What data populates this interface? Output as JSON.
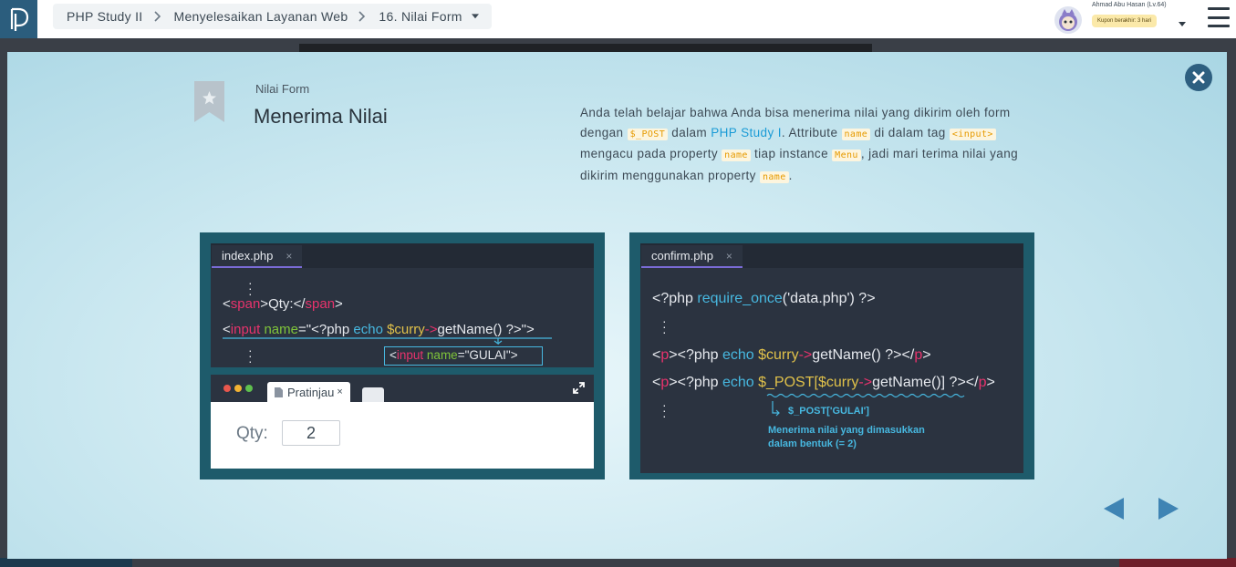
{
  "breadcrumb": {
    "course": "PHP Study II",
    "chapter": "Menyelesaikan Layanan Web",
    "lesson": "16. Nilai Form"
  },
  "user": {
    "name": "Ahmad Abu Hasan (Lv.64)",
    "coupon": "Kupon berakhir: 3 hari"
  },
  "slide": {
    "section": "Nilai Form",
    "title": "Menerima Nilai",
    "desc": {
      "t1": "Anda telah belajar bahwa Anda bisa menerima nilai yang dikirim oleh form dengan ",
      "c1": "$_POST",
      "t2": " dalam ",
      "link": "PHP Study I",
      "t3": ". Attribute ",
      "c2": "name",
      "t4": " di dalam tag ",
      "c3": "<input>",
      "t5": " mengacu pada property ",
      "c4": "name",
      "t6": " tiap instance ",
      "c5": "Menu",
      "t7": ", jadi mari terima nilai yang dikirim menggunakan property ",
      "c6": "name",
      "t8": "."
    }
  },
  "left_figure": {
    "tab": "index.php",
    "tab_close": "×",
    "line1": {
      "lt": "<",
      "tag": "span",
      "gt": ">",
      "text": "Qty:",
      "lt2": "</",
      "tag2": "span",
      "gt2": ">"
    },
    "line2": {
      "lt": "<",
      "tag": "input",
      "attr": " name",
      "eq": "=\"",
      "php": "<?php ",
      "echo": "echo ",
      "var": "$curry",
      "arrow": "->",
      "fn": "getName() ?>",
      "end": "\">"
    },
    "callout": {
      "lt": "<",
      "tag": "input",
      "attr": " name",
      "eq": "=\"",
      "val": "GULAI",
      "end": "\">"
    },
    "preview_tab": "Pratinjau",
    "preview_tab_close": "×",
    "qty_label": "Qty:",
    "qty_value": "2"
  },
  "right_figure": {
    "tab": "confirm.php",
    "tab_close": "×",
    "line1": {
      "php": "<?php ",
      "fn": "require_once",
      "args": "('data.php')",
      "end": " ?>"
    },
    "line2": {
      "lt": "<",
      "tag": "p",
      "gt": ">",
      "php": "<?php ",
      "echo": "echo ",
      "var": "$curry",
      "arrow": "->",
      "call": "getName() ?>",
      "lt2": "</",
      "tag2": "p",
      "gt2": ">"
    },
    "line3": {
      "lt": "<",
      "tag": "p",
      "gt": ">",
      "php": "<?php ",
      "echo": "echo ",
      "post": "$_POST[",
      "var": "$curry",
      "arrow": "->",
      "call": "getName()]",
      "end": " ?>",
      "lt2": "</",
      "tag2": "p",
      "gt2": ">"
    },
    "note_code": "$_POST['GULAI']",
    "note_line1": "Menerima nilai yang dimasukkan",
    "note_line2": "dalam bentuk (= 2)"
  },
  "colors": {
    "modal_bg": "#cde9f1",
    "figure_border": "#1e5b6b",
    "editor_bg": "#2b3340",
    "accent": "#2e5f80",
    "code_inline": "#e69a00",
    "link": "#1a9bd6"
  }
}
